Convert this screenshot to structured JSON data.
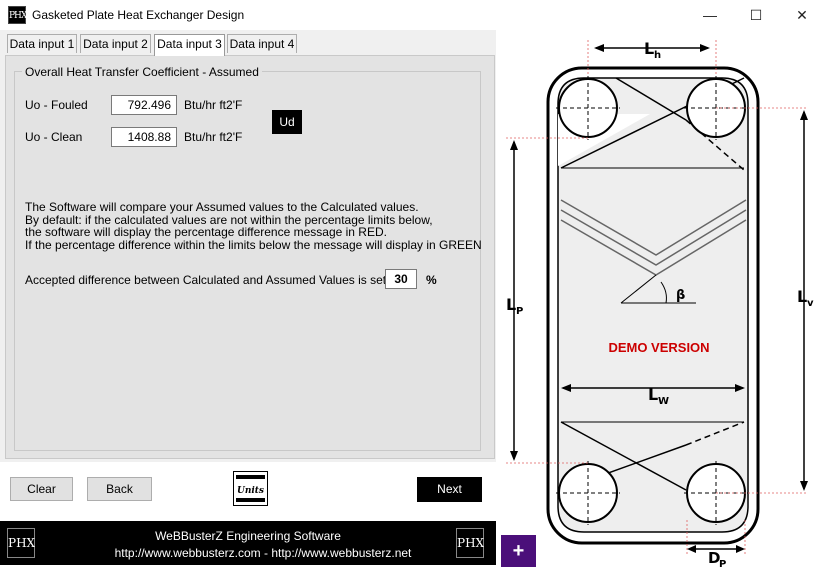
{
  "window": {
    "title": "Gasketed Plate Heat Exchanger Design",
    "icon_text": "PHX",
    "minimize": "—",
    "maximize": "☐",
    "close": "✕"
  },
  "tabs": [
    {
      "label": "Data input 1"
    },
    {
      "label": "Data input 2"
    },
    {
      "label": "Data input 3",
      "active": true
    },
    {
      "label": "Data input 4"
    }
  ],
  "group": {
    "title": "Overall Heat Transfer Coefficient - Assumed",
    "fouled_label": "Uo - Fouled",
    "fouled_value": "792.496",
    "clean_label": "Uo - Clean",
    "clean_value": "1408.88",
    "unit": "Btu/hr ft2'F",
    "ud_button": "Ud",
    "para": [
      "The Software will compare your Assumed values to the Calculated values.",
      "By default: if the calculated values are not within the percentage limits below,",
      "the software will display the percentage difference message in RED.",
      "If the percentage difference within the limits below the message will display in GREEN"
    ],
    "accepted_label": "Accepted difference between Calculated and Assumed Values is set to",
    "accepted_value": "30",
    "percent": "%"
  },
  "buttons": {
    "clear": "Clear",
    "back": "Back",
    "units": "Units",
    "next": "Next",
    "plus": "+"
  },
  "footer": {
    "company": "WeBBusterZ Engineering Software",
    "urls": "http://www.webbusterz.com - http://www.webbusterz.net",
    "logo_text": "PHX"
  },
  "diagram": {
    "lh": "L",
    "lh_sub": "h",
    "lp": "L",
    "lp_sub": "P",
    "lv": "L",
    "lv_sub": "v",
    "lw": "L",
    "lw_sub": "W",
    "dp": "D",
    "dp_sub": "P",
    "beta": "β",
    "demo": "DEMO VERSION",
    "demo_color": "#cc0000"
  }
}
